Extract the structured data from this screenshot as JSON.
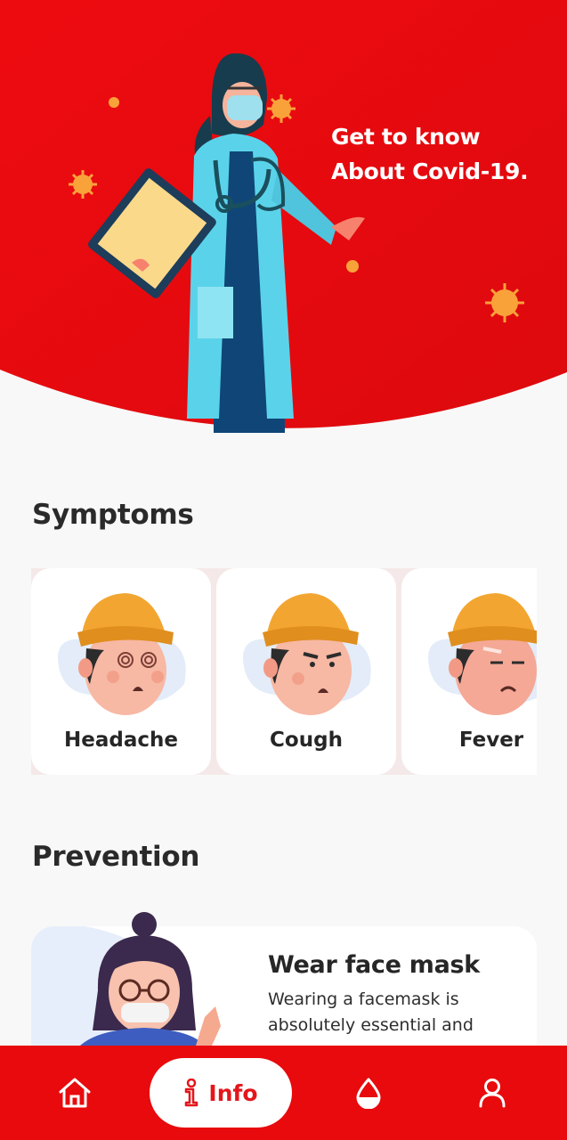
{
  "hero": {
    "title_line1": "Get to know",
    "title_line2": "About Covid-19."
  },
  "sections": {
    "symptoms_title": "Symptoms",
    "prevention_title": "Prevention"
  },
  "symptoms": [
    {
      "label": "Headache",
      "icon": "headache-illustration"
    },
    {
      "label": "Cough",
      "icon": "cough-illustration"
    },
    {
      "label": "Fever",
      "icon": "fever-illustration"
    }
  ],
  "prevention": {
    "title": "Wear face mask",
    "description": "Wearing a facemask is absolutely essential and"
  },
  "nav": {
    "active_label": "Info",
    "items": [
      "home-icon",
      "info-icon",
      "drop-icon",
      "user-icon"
    ]
  },
  "colors": {
    "brand_red": "#e80a0d",
    "background": "#f8f8f8",
    "card": "#ffffff",
    "text_dark": "#2b2b2b"
  }
}
